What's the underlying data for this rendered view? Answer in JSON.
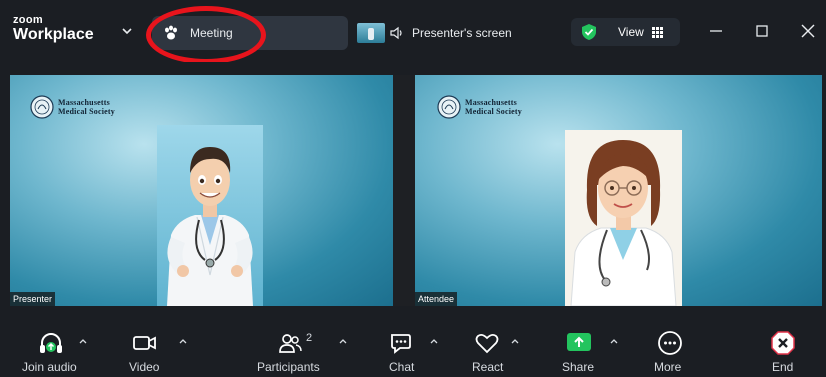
{
  "titlebar": {
    "logo_top": "zoom",
    "logo_bottom": "Workplace",
    "meeting_label": "Meeting",
    "presenter_screen_label": "Presenter's screen",
    "view_label": "View"
  },
  "tiles": [
    {
      "org_line1": "Massachusetts",
      "org_line2": "Medical Society",
      "name": "Presenter"
    },
    {
      "org_line1": "Massachusetts",
      "org_line2": "Medical Society",
      "name": "Attendee"
    }
  ],
  "toolbar": {
    "join_audio": "Join audio",
    "video": "Video",
    "participants": "Participants",
    "participants_count": "2",
    "chat": "Chat",
    "react": "React",
    "share": "Share",
    "more": "More",
    "end": "End"
  },
  "colors": {
    "background": "#1b1e23",
    "accent_green": "#23c45e",
    "highlight_red": "#e8141c",
    "end_red": "#e2334a"
  }
}
